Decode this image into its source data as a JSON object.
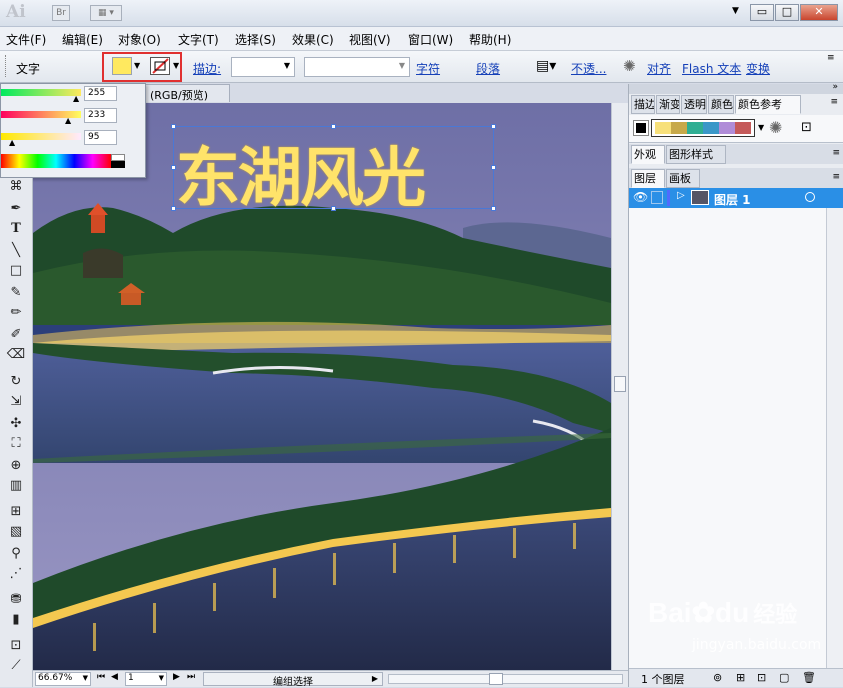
{
  "app": {
    "logo": "Ai",
    "bridge_label": "Br"
  },
  "menu": [
    "文件(F)",
    "编辑(E)",
    "对象(O)",
    "文字(T)",
    "选择(S)",
    "效果(C)",
    "视图(V)",
    "窗口(W)",
    "帮助(H)"
  ],
  "control_bar": {
    "mode_label": "文字",
    "stroke_label": "描边:",
    "char_link": "字符",
    "para_link": "段落",
    "opacity_link": "不透...",
    "align_link": "对齐",
    "flash_link": "Flash 文本",
    "transform_link": "变换"
  },
  "color_popup": {
    "r_value": "255",
    "g_value": "233",
    "b_value": "95"
  },
  "document": {
    "tab_title": "(RGB/预览)",
    "headline": "东湖风光"
  },
  "colors": {
    "fill": "#ffe95f",
    "headline": "#ffe36a",
    "accent_red": "#e03030",
    "layer_blue": "#2a8fe6"
  },
  "panels": {
    "top_tabs": [
      "描边",
      "渐变",
      "透明",
      "颜色",
      "颜色参考"
    ],
    "swatches": [
      "#f7e07a",
      "#c7a94a",
      "#2fae93",
      "#3a97c8",
      "#b08cd8",
      "#c55a5a"
    ],
    "mid_tabs": [
      "外观",
      "图形样式"
    ],
    "layer_tabs": [
      "图层",
      "画板"
    ],
    "layer_name": "图层 1",
    "layer_count": "1 个图层"
  },
  "status": {
    "zoom": "66.67%",
    "page": "1",
    "mode": "编组选择"
  },
  "watermark": {
    "brand": "Bai",
    "brand2": "du",
    "brand_cn": "经验",
    "url": "jingyan.baidu.com"
  }
}
